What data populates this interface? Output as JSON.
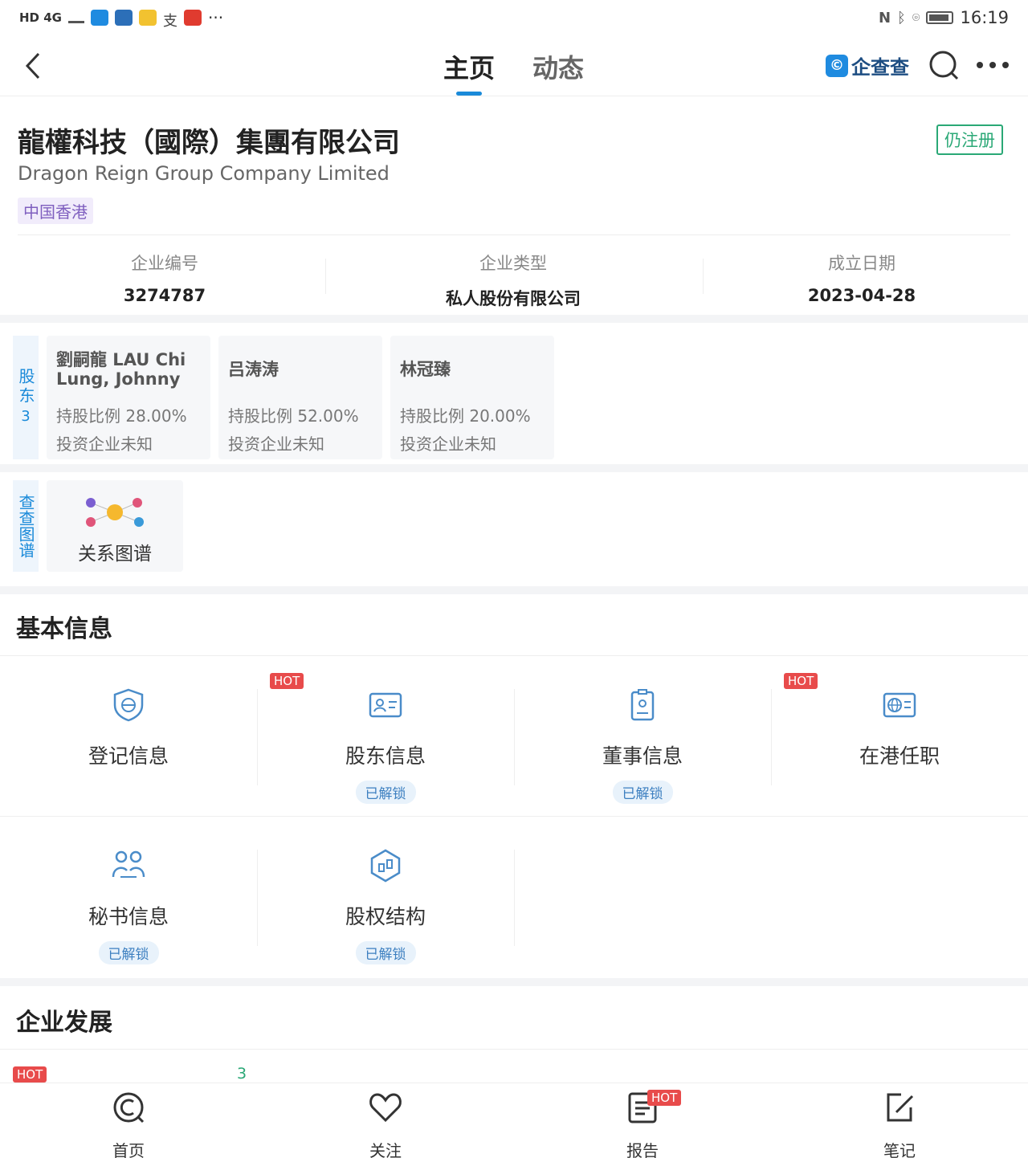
{
  "status_bar": {
    "left_text": "HD 4G",
    "time": "16:19",
    "more": "···"
  },
  "nav": {
    "tabs": [
      {
        "label": "主页",
        "active": true
      },
      {
        "label": "动态",
        "active": false
      }
    ],
    "brand": "企查查"
  },
  "company": {
    "name_zh": "龍權科技（國際）集團有限公司",
    "name_en": "Dragon Reign Group Company Limited",
    "status": "仍注册",
    "region": "中国香港",
    "info": [
      {
        "label": "企业编号",
        "value": "3274787"
      },
      {
        "label": "企业类型",
        "value": "私人股份有限公司"
      },
      {
        "label": "成立日期",
        "value": "2023-04-28"
      }
    ]
  },
  "shareholders": {
    "side_label": "股东",
    "count": "3",
    "items": [
      {
        "name": "劉嗣龍 LAU Chi Lung, Johnny",
        "ratio": "持股比例 28.00%",
        "invest": "投资企业未知"
      },
      {
        "name": "吕涛涛",
        "ratio": "持股比例 52.00%",
        "invest": "投资企业未知"
      },
      {
        "name": "林冠臻",
        "ratio": "持股比例 20.00%",
        "invest": "投资企业未知"
      }
    ]
  },
  "graph": {
    "side_label": "查查图谱",
    "card_label": "关系图谱"
  },
  "basic_info": {
    "title": "基本信息",
    "items": [
      {
        "label": "登记信息",
        "hot": false,
        "unlock": ""
      },
      {
        "label": "股东信息",
        "hot": true,
        "unlock": "已解锁"
      },
      {
        "label": "董事信息",
        "hot": false,
        "unlock": "已解锁"
      },
      {
        "label": "在港任职",
        "hot": true,
        "unlock": ""
      },
      {
        "label": "秘书信息",
        "hot": false,
        "unlock": "已解锁"
      },
      {
        "label": "股权结构",
        "hot": false,
        "unlock": "已解锁"
      }
    ],
    "hot_label": "HOT"
  },
  "development": {
    "title": "企业发展",
    "count": "3",
    "hot_label": "HOT"
  },
  "bottom_nav": [
    {
      "label": "首页",
      "icon": "home-icon"
    },
    {
      "label": "关注",
      "icon": "heart-icon"
    },
    {
      "label": "报告",
      "icon": "report-icon",
      "hot": "HOT"
    },
    {
      "label": "笔记",
      "icon": "note-icon"
    }
  ],
  "colors": {
    "accent": "#1a8ad9",
    "status_green": "#2aa876",
    "hot_red": "#e84b4b",
    "region_purple": "#7f5fbf"
  }
}
